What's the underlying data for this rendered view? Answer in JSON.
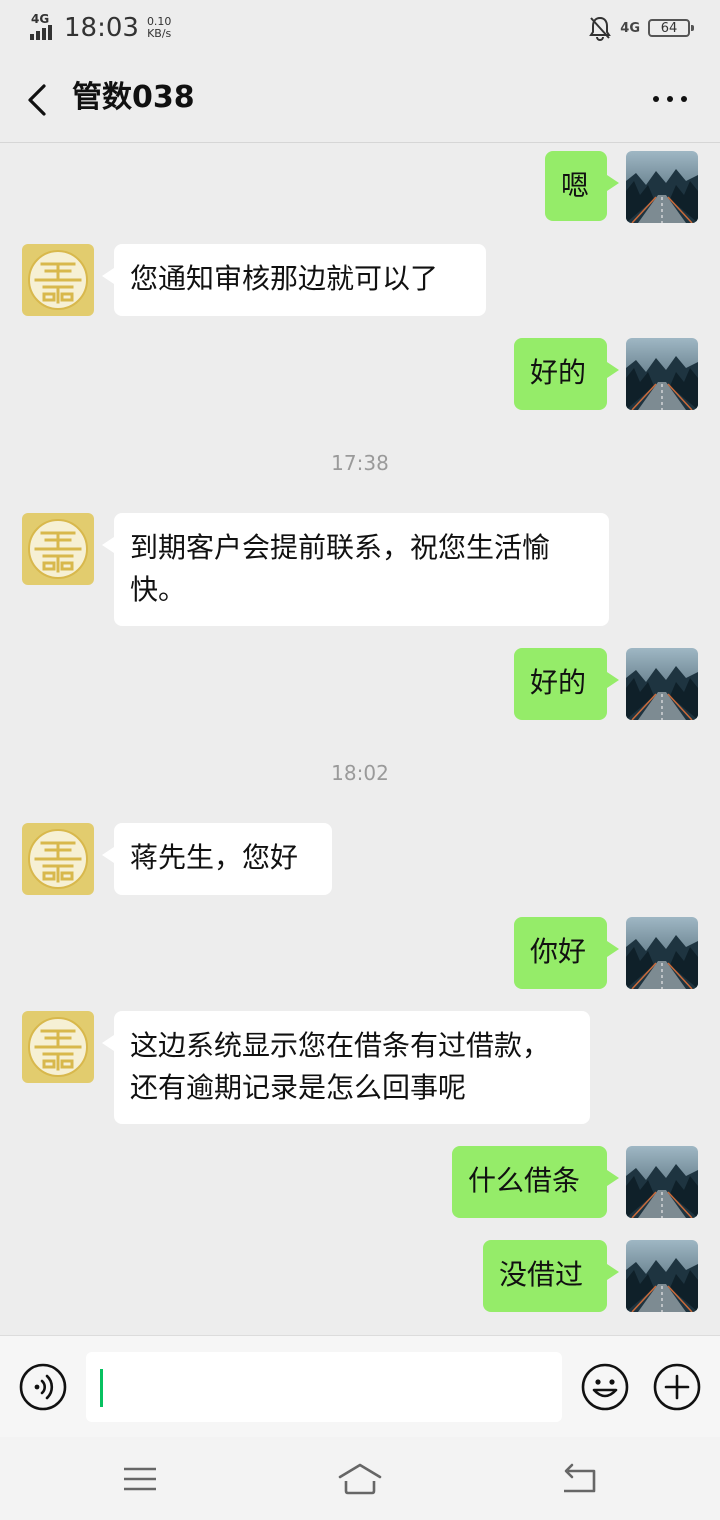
{
  "status_bar": {
    "network": "4G",
    "time": "18:03",
    "speed_value": "0.10",
    "speed_unit": "KB/s",
    "network_right": "4G",
    "battery": "64"
  },
  "header": {
    "title": "管数038",
    "back_icon": "chevron-left-icon",
    "more_icon": "more-horizontal-icon"
  },
  "messages": [
    {
      "side": "out",
      "text": "嗯"
    },
    {
      "side": "in",
      "text": "您通知审核那边就可以了"
    },
    {
      "side": "out",
      "text": "好的"
    },
    {
      "type": "time",
      "text": "17:38"
    },
    {
      "side": "in",
      "text": "到期客户会提前联系，祝您生活愉\n快。"
    },
    {
      "side": "out",
      "text": "好的"
    },
    {
      "type": "time",
      "text": "18:02"
    },
    {
      "side": "in",
      "text": "蒋先生，您好"
    },
    {
      "side": "out",
      "text": "你好"
    },
    {
      "side": "in",
      "text": "这边系统显示您在借条有过借款，\n还有逾期记录是怎么回事呢"
    },
    {
      "side": "out",
      "text": "什么借条"
    },
    {
      "side": "out",
      "text": "没借过"
    }
  ],
  "input_bar": {
    "voice_icon": "voice-icon",
    "emoji_icon": "emoji-icon",
    "plus_icon": "plus-icon",
    "value": ""
  },
  "nav_bar": {
    "menu_icon": "menu-icon",
    "home_icon": "home-icon",
    "back_icon": "back-icon"
  },
  "colors": {
    "outgoing_bubble": "#95ec69",
    "incoming_bubble": "#ffffff",
    "background": "#ededed",
    "cursor": "#07c160"
  }
}
